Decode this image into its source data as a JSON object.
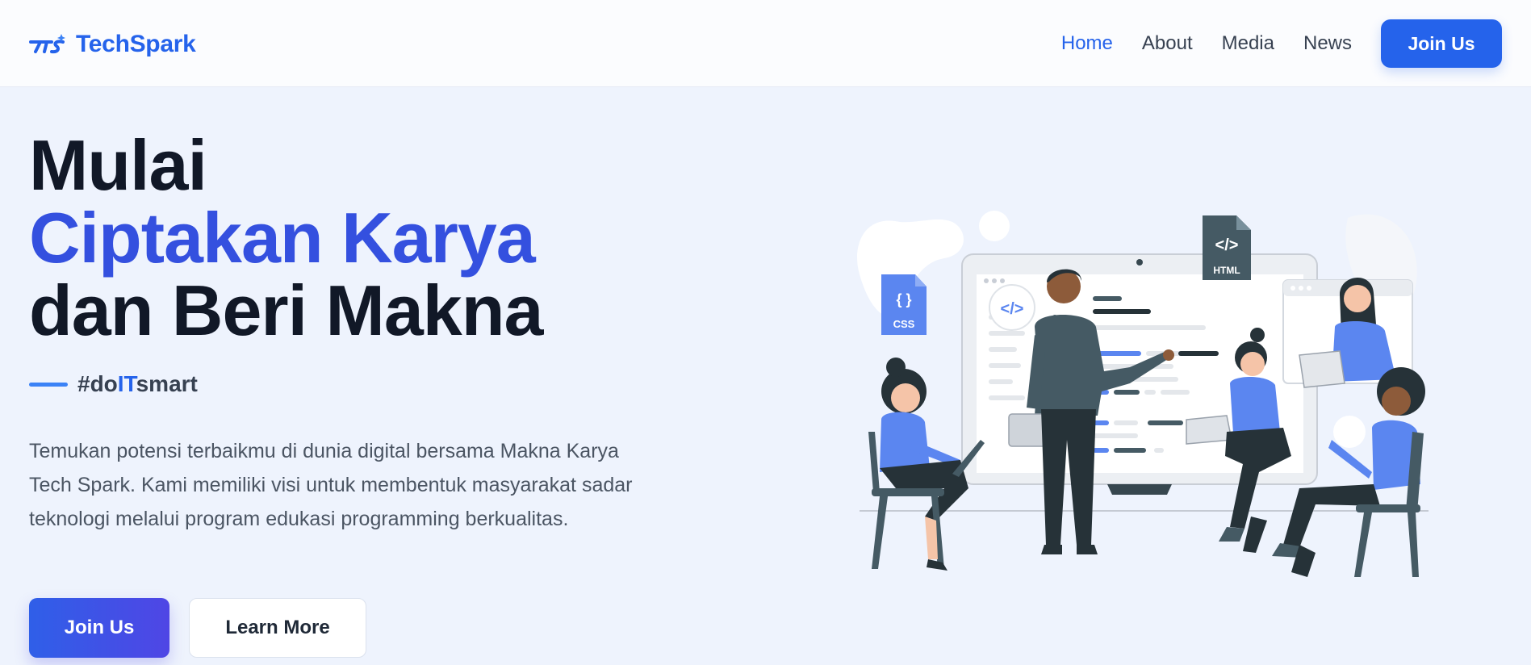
{
  "nav": {
    "brand": "TechSpark",
    "links": [
      "Home",
      "About",
      "Media",
      "News"
    ],
    "active": "Home",
    "join_label": "Join Us"
  },
  "hero": {
    "title_line1": "Mulai",
    "title_line2": "Ciptakan Karya",
    "title_line3": "dan Beri Makna",
    "tagline_pre": "#do",
    "tagline_highlight": "IT",
    "tagline_post": "smart",
    "description": "Temukan potensi terbaikmu di dunia digital bersama Makna Karya Tech Spark. Kami memiliki visi untuk membentuk masyarakat sadar teknologi melalui program edukasi programming berkualitas.",
    "primary_button": "Join Us",
    "secondary_button": "Learn More"
  },
  "illustration": {
    "css_label": "CSS",
    "css_glyph": "{ }",
    "html_label": "HTML",
    "code_glyph": "</>"
  },
  "colors": {
    "accent": "#2563eb",
    "accent_dark": "#3450df",
    "hero_bg": "#eef3fd",
    "figure_blue": "#5b86f0",
    "figure_dark": "#263238"
  }
}
